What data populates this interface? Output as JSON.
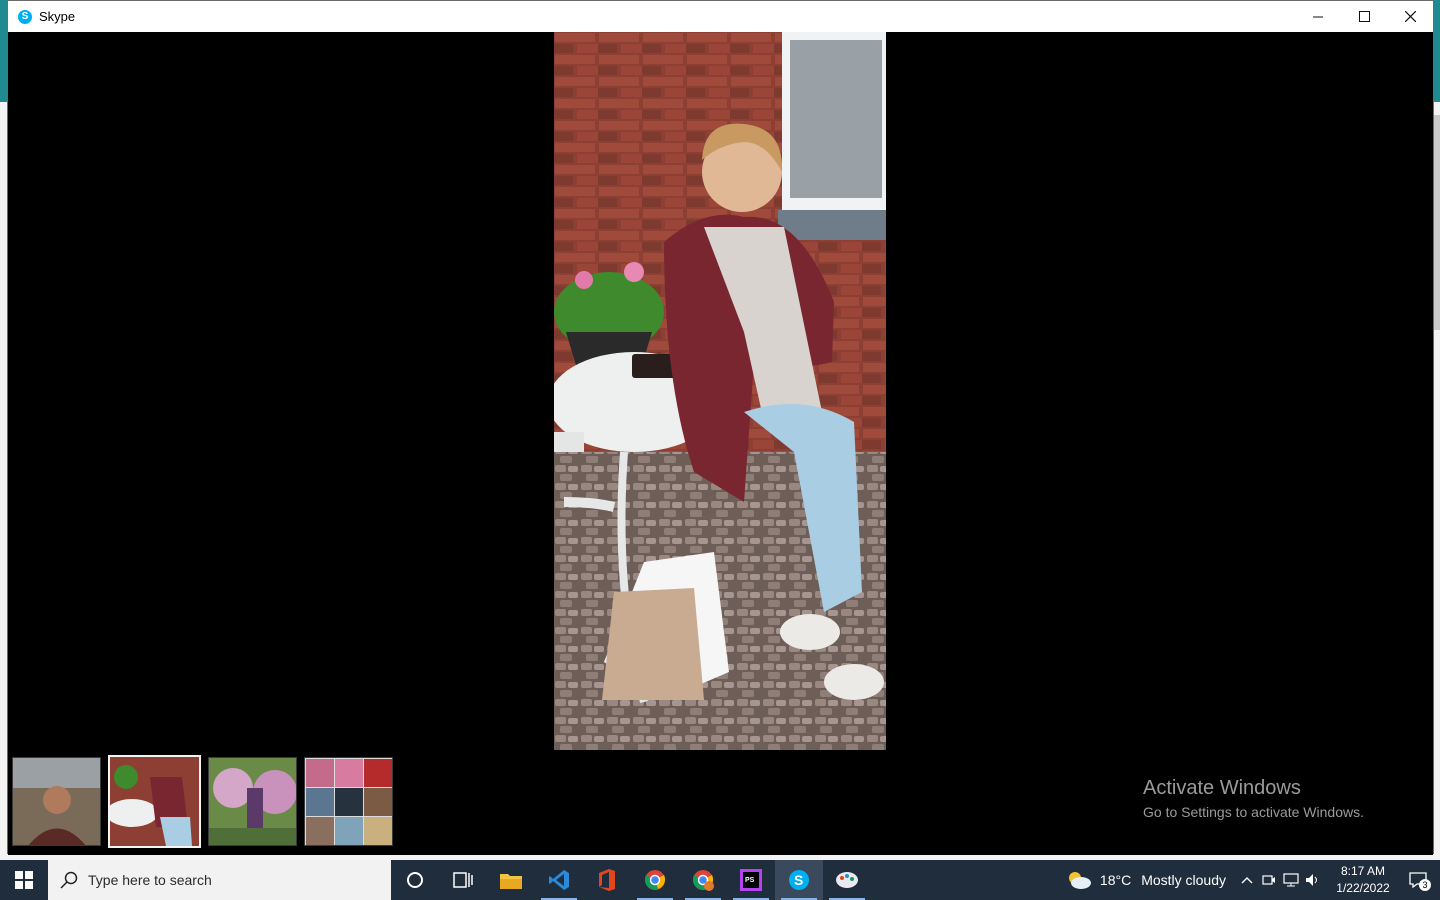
{
  "window": {
    "title": "Skype",
    "app_icon_letter": "S"
  },
  "controls": {
    "minimize": "minimize-icon",
    "maximize": "maximize-icon",
    "close": "close-icon"
  },
  "viewer": {
    "thumbnails": [
      {
        "label": "photo-1",
        "selected": false
      },
      {
        "label": "photo-2",
        "selected": true
      },
      {
        "label": "photo-3",
        "selected": false
      },
      {
        "label": "photo-4",
        "selected": false
      }
    ]
  },
  "watermark": {
    "line1": "Activate Windows",
    "line2": "Go to Settings to activate Windows."
  },
  "taskbar": {
    "search_placeholder": "Type here to search",
    "apps": [
      "cortana-icon",
      "task-view-icon",
      "file-explorer-icon",
      "vscode-icon",
      "office-icon",
      "chrome-icon",
      "chrome-profile-icon",
      "phpstorm-icon",
      "skype-icon",
      "paint-icon"
    ],
    "weather": {
      "temp": "18°C",
      "condition": "Mostly cloudy"
    },
    "clock": {
      "time": "8:17 AM",
      "date": "1/22/2022"
    },
    "notifications": "3"
  },
  "colors": {
    "skype_blue": "#00aff0",
    "taskbar": "#1f2d3c",
    "viewer_bg": "#000000"
  }
}
